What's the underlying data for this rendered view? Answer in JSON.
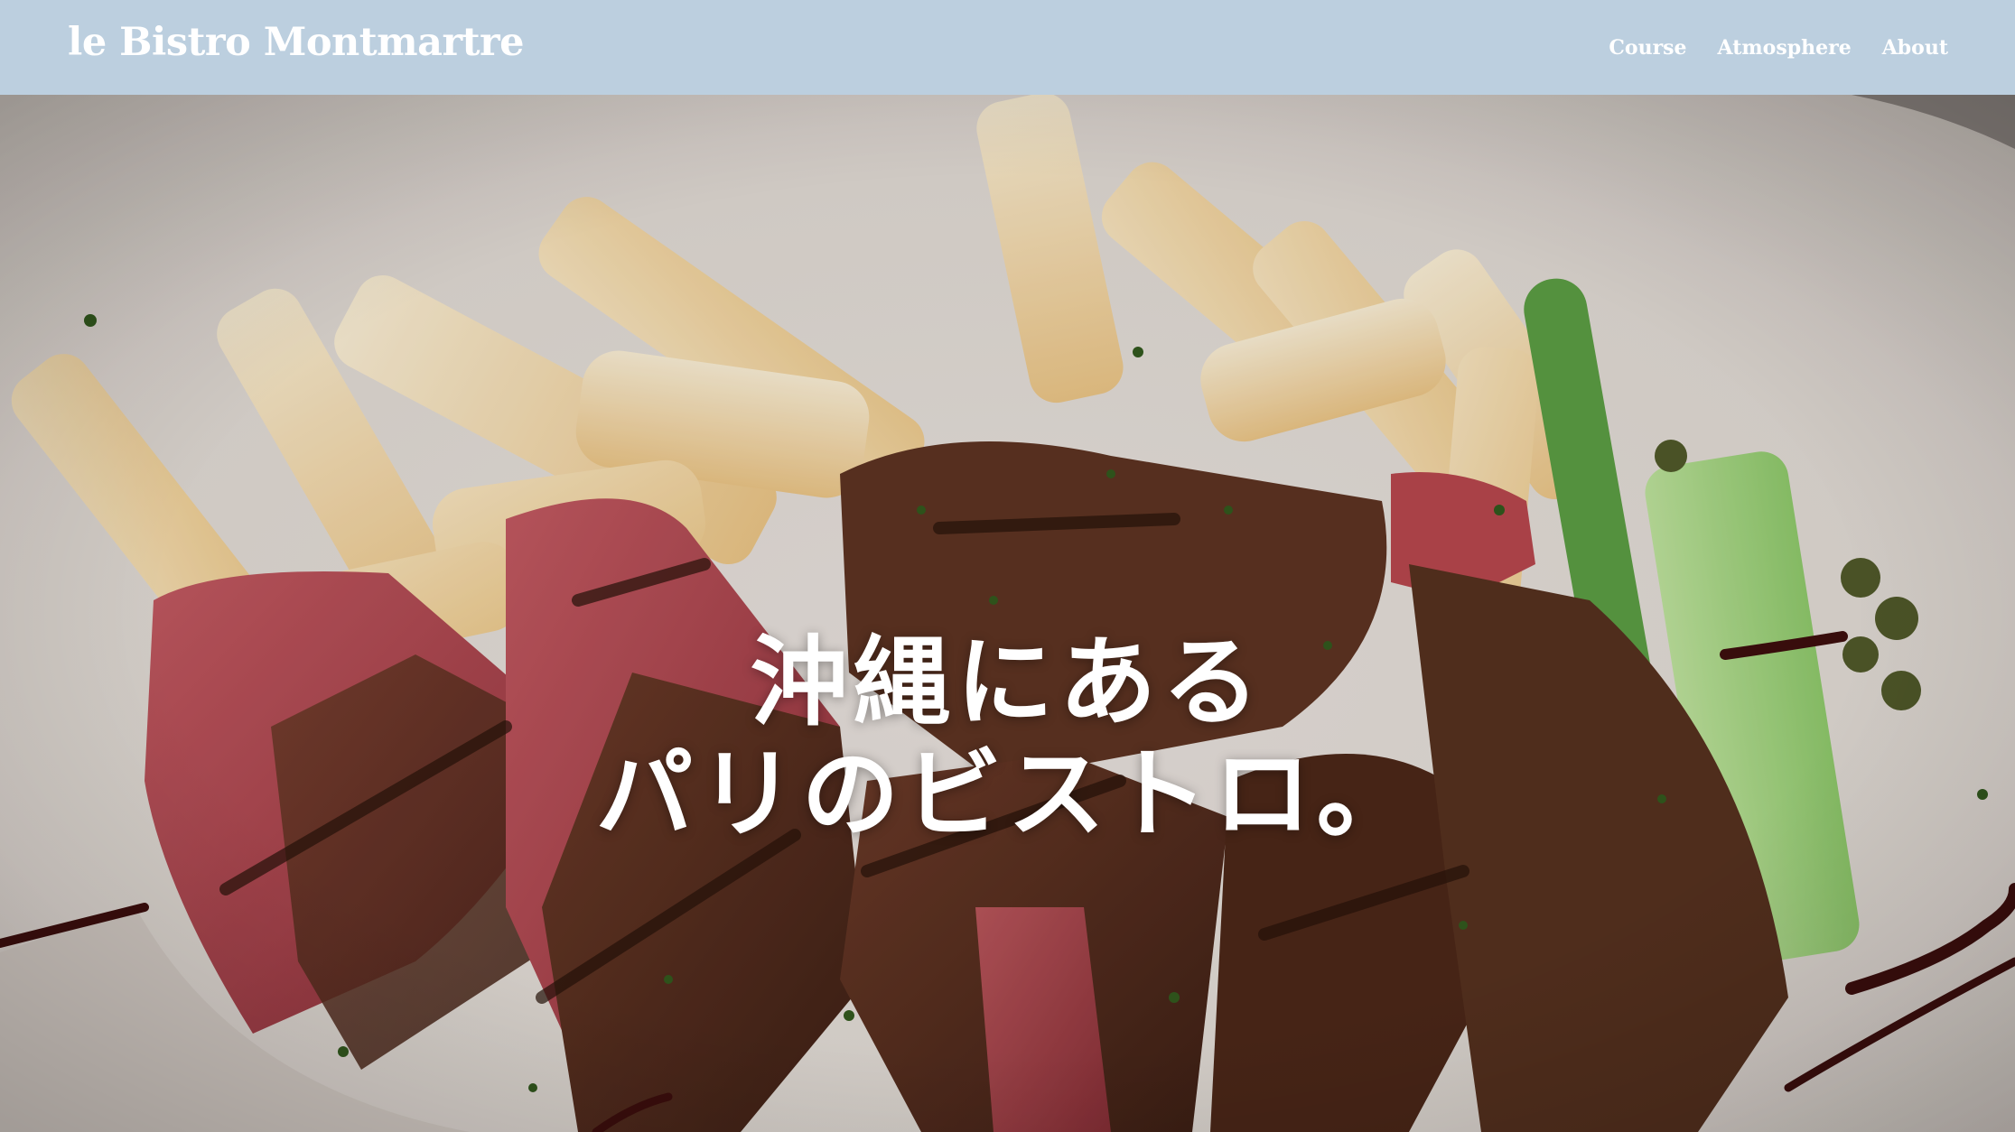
{
  "header": {
    "brand": "le Bistro Montmartre",
    "nav": [
      {
        "label": "Course"
      },
      {
        "label": "Atmosphere"
      },
      {
        "label": "About"
      }
    ]
  },
  "hero": {
    "headline_line1": "沖縄にある",
    "headline_line2": "パリのビストロ。",
    "image_description_icon": "steak-frites-photo"
  },
  "colors": {
    "header_bg": "#bccfdf",
    "text": "#ffffff"
  }
}
